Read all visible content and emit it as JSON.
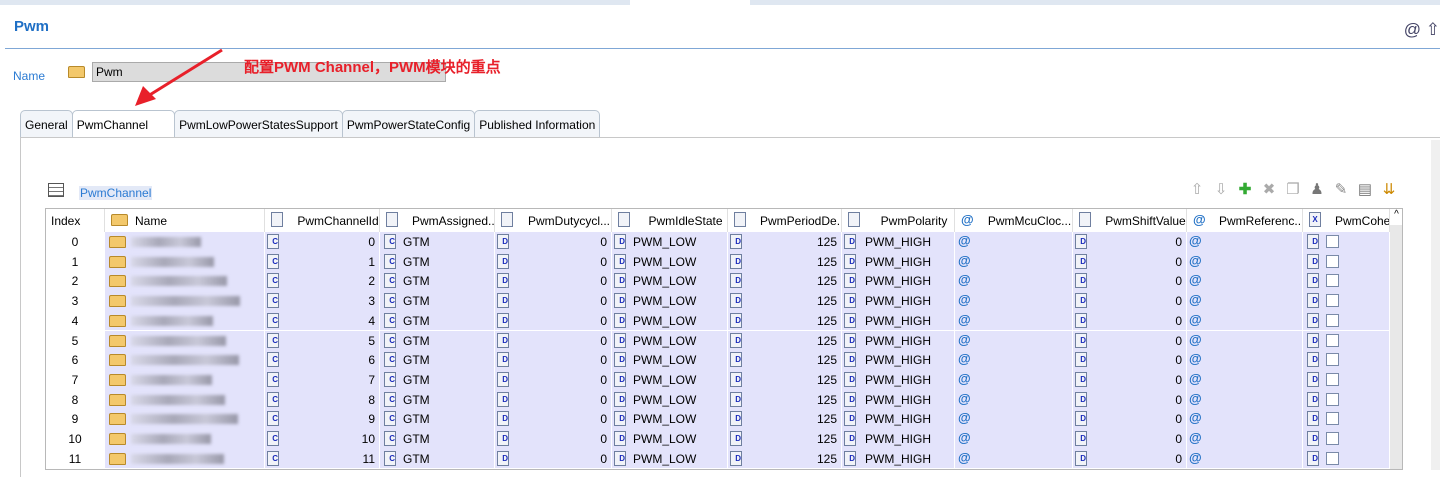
{
  "header": {
    "title": "Pwm"
  },
  "name_field": {
    "label": "Name",
    "value": "Pwm"
  },
  "annotation": "配置PWM Channel，PWM模块的重点",
  "tabs": [
    "General",
    "PwmChannel",
    "PwmLowPowerStatesSupport",
    "PwmPowerStateConfig",
    "Published Information"
  ],
  "active_tab": "PwmChannel",
  "section": {
    "title": "PwmChannel"
  },
  "toolbar": [
    "move-up-icon",
    "move-down-icon",
    "add-icon",
    "delete-icon",
    "copy-icon",
    "user-icon",
    "edit-icon",
    "table-edit-icon",
    "import-icon"
  ],
  "columns": [
    "Index",
    "Name",
    "PwmChannelId",
    "PwmAssigned...",
    "PwmDutycycl...",
    "PwmIdleState",
    "PwmPeriodDe...",
    "PwmPolarity",
    "PwmMcuCloc...",
    "PwmShiftValue",
    "PwmReferenc...",
    "PwmCohe"
  ],
  "rows": [
    {
      "index": "0",
      "channel_id": "0",
      "assigned": "GTM",
      "duty": "0",
      "idle": "PWM_LOW",
      "period": "125",
      "polarity": "PWM_HIGH",
      "shift": "0"
    },
    {
      "index": "1",
      "channel_id": "1",
      "assigned": "GTM",
      "duty": "0",
      "idle": "PWM_LOW",
      "period": "125",
      "polarity": "PWM_HIGH",
      "shift": "0"
    },
    {
      "index": "2",
      "channel_id": "2",
      "assigned": "GTM",
      "duty": "0",
      "idle": "PWM_LOW",
      "period": "125",
      "polarity": "PWM_HIGH",
      "shift": "0"
    },
    {
      "index": "3",
      "channel_id": "3",
      "assigned": "GTM",
      "duty": "0",
      "idle": "PWM_LOW",
      "period": "125",
      "polarity": "PWM_HIGH",
      "shift": "0"
    },
    {
      "index": "4",
      "channel_id": "4",
      "assigned": "GTM",
      "duty": "0",
      "idle": "PWM_LOW",
      "period": "125",
      "polarity": "PWM_HIGH",
      "shift": "0"
    },
    {
      "index": "5",
      "channel_id": "5",
      "assigned": "GTM",
      "duty": "0",
      "idle": "PWM_LOW",
      "period": "125",
      "polarity": "PWM_HIGH",
      "shift": "0"
    },
    {
      "index": "6",
      "channel_id": "6",
      "assigned": "GTM",
      "duty": "0",
      "idle": "PWM_LOW",
      "period": "125",
      "polarity": "PWM_HIGH",
      "shift": "0"
    },
    {
      "index": "7",
      "channel_id": "7",
      "assigned": "GTM",
      "duty": "0",
      "idle": "PWM_LOW",
      "period": "125",
      "polarity": "PWM_HIGH",
      "shift": "0"
    },
    {
      "index": "8",
      "channel_id": "8",
      "assigned": "GTM",
      "duty": "0",
      "idle": "PWM_LOW",
      "period": "125",
      "polarity": "PWM_HIGH",
      "shift": "0"
    },
    {
      "index": "9",
      "channel_id": "9",
      "assigned": "GTM",
      "duty": "0",
      "idle": "PWM_LOW",
      "period": "125",
      "polarity": "PWM_HIGH",
      "shift": "0"
    },
    {
      "index": "10",
      "channel_id": "10",
      "assigned": "GTM",
      "duty": "0",
      "idle": "PWM_LOW",
      "period": "125",
      "polarity": "PWM_HIGH",
      "shift": "0"
    },
    {
      "index": "11",
      "channel_id": "11",
      "assigned": "GTM",
      "duty": "0",
      "idle": "PWM_LOW",
      "period": "125",
      "polarity": "PWM_HIGH",
      "shift": "0"
    }
  ]
}
